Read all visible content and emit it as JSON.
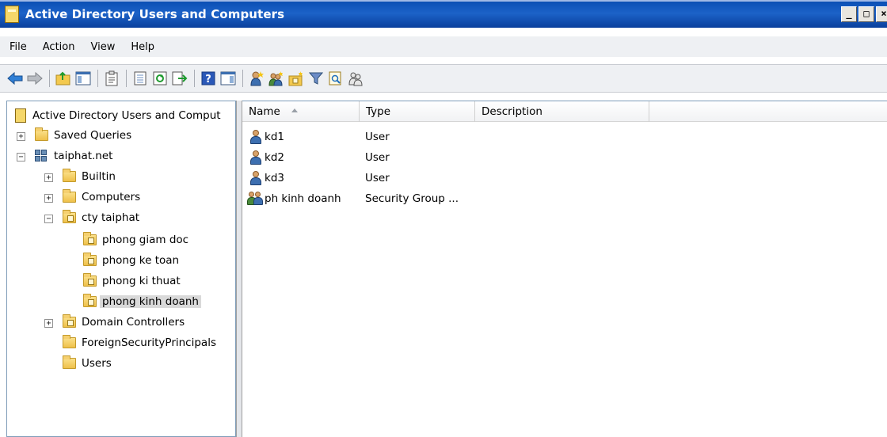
{
  "window": {
    "title": "Active Directory Users and Computers"
  },
  "menu": [
    "File",
    "Action",
    "View",
    "Help"
  ],
  "toolbar": {
    "buttons": [
      "back-icon",
      "forward-icon",
      "up-folder-icon",
      "show-hide-console-tree-icon",
      "properties-icon",
      "export-list-icon",
      "refresh-icon",
      "export-icon",
      "help-icon",
      "show-action-pane-icon",
      "new-user-icon",
      "new-group-icon",
      "new-ou-icon",
      "filter-icon",
      "find-icon",
      "add-to-group-icon"
    ]
  },
  "tree": {
    "root": "Active Directory Users and Comput",
    "saved_queries": "Saved Queries",
    "domain": "taiphat.net",
    "builtin": "Builtin",
    "computers": "Computers",
    "cty": "cty taiphat",
    "ou1": "phong giam doc",
    "ou2": "phong ke toan",
    "ou3": "phong ki thuat",
    "ou4": "phong kinh doanh",
    "dc": "Domain Controllers",
    "fsp": "ForeignSecurityPrincipals",
    "users": "Users"
  },
  "list": {
    "columns": [
      "Name",
      "Type",
      "Description"
    ],
    "rows": [
      {
        "name": "kd1",
        "type": "User",
        "icon": "user-icon"
      },
      {
        "name": "kd2",
        "type": "User",
        "icon": "user-icon"
      },
      {
        "name": "kd3",
        "type": "User",
        "icon": "user-icon"
      },
      {
        "name": "ph kinh doanh",
        "type": "Security Group ...",
        "icon": "group-icon"
      }
    ]
  },
  "colors": {
    "titlebar": "#0b4fb4",
    "selection": "#d9d9d9",
    "folder": "#f5d070"
  }
}
